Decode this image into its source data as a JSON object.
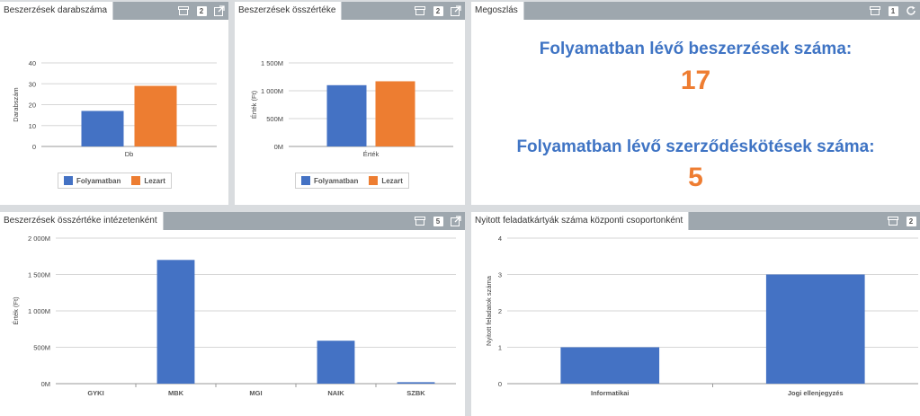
{
  "colors": {
    "blue": "#4472c4",
    "orange": "#ed7d31",
    "header": "#9ea7ae",
    "kpi_label": "#3f74c4",
    "kpi_value": "#ee7d32"
  },
  "panels": {
    "count": {
      "title": "Beszerzések darabszáma",
      "badge": "2",
      "legend": [
        "Folyamatban",
        "Lezart"
      ],
      "chart_data": {
        "type": "bar",
        "categories": [
          "Db"
        ],
        "series": [
          {
            "name": "Folyamatban",
            "values": [
              17
            ]
          },
          {
            "name": "Lezart",
            "values": [
              29
            ]
          }
        ],
        "ylabel": "Darabszám",
        "yticks": [
          "0",
          "10",
          "20",
          "30",
          "40"
        ],
        "ylim": [
          0,
          40
        ]
      }
    },
    "value": {
      "title": "Beszerzések összértéke",
      "badge": "2",
      "legend": [
        "Folyamatban",
        "Lezart"
      ],
      "chart_data": {
        "type": "bar",
        "categories": [
          "Érték"
        ],
        "series": [
          {
            "name": "Folyamatban",
            "values": [
              1100
            ]
          },
          {
            "name": "Lezart",
            "values": [
              1170
            ]
          }
        ],
        "ylabel": "Érték (Ft)",
        "yticks": [
          "0M",
          "500M",
          "1 000M",
          "1 500M"
        ],
        "ylim": [
          0,
          1500
        ]
      }
    },
    "distribution": {
      "title": "Megoszlás",
      "badge": "1",
      "line1_label": "Folyamatban lévő beszerzések száma:",
      "line1_value": "17",
      "line2_label": "Folyamatban lévő szerződéskötések száma:",
      "line2_value": "5"
    },
    "by_institution": {
      "title": "Beszerzések összértéke intézetenként",
      "badge": "5",
      "chart_data": {
        "type": "bar",
        "categories": [
          "GYKI",
          "MBK",
          "MGI",
          "NAIK",
          "SZBK"
        ],
        "values": [
          0,
          1700,
          0,
          590,
          20
        ],
        "ylabel": "Érték (Ft)",
        "yticks": [
          "0M",
          "500M",
          "1 000M",
          "1 500M",
          "2 000M"
        ],
        "ylim": [
          0,
          2000
        ]
      }
    },
    "tasks": {
      "title": "Nyitott feladatkártyák száma központi csoportonként",
      "badge": "2",
      "chart_data": {
        "type": "bar",
        "categories": [
          "Informatikai",
          "Jogi ellenjegyzés"
        ],
        "values": [
          1,
          3
        ],
        "ylabel": "Nyitott feladatok száma",
        "yticks": [
          "0",
          "1",
          "2",
          "3",
          "4"
        ],
        "ylim": [
          0,
          4
        ]
      }
    }
  }
}
